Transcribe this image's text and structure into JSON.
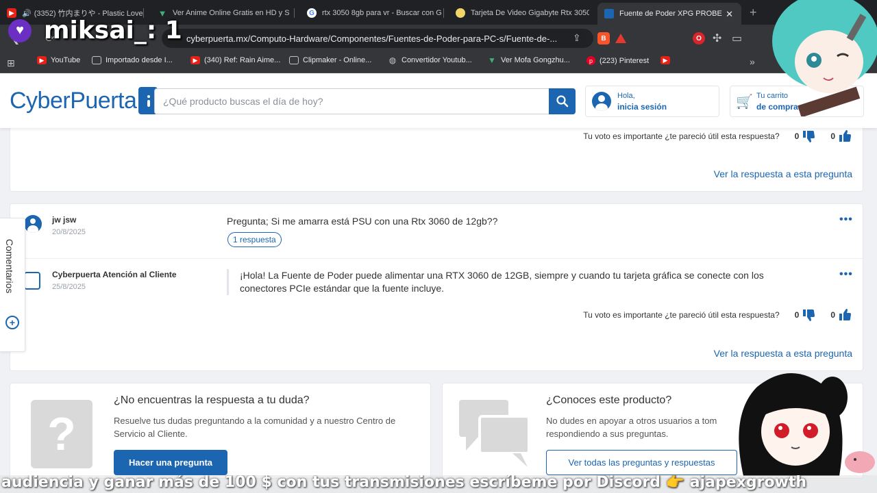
{
  "browser": {
    "tabs": [
      {
        "title": "(3352) 竹内まりや - Plastic Love",
        "icon": "youtube-icon",
        "icon_color": "#e62117"
      },
      {
        "title": "Ver Anime Online Gratis en HD y S",
        "icon": "vue-logo-icon",
        "icon_color": "#3eaf7c"
      },
      {
        "title": "rtx 3050 8gb para vr - Buscar con G",
        "icon": "google-icon",
        "icon_color": "#4285f4"
      },
      {
        "title": "Tarjeta De Video Gigabyte Rtx 3050",
        "icon": "shop-icon",
        "icon_color": "#f3d36b"
      },
      {
        "title": "Fuente de Poder XPG PROBE",
        "icon": "cyberpuerta-icon",
        "icon_color": "#1b65b1"
      }
    ],
    "url": "cyberpuerta.mx/Computo-Hardware/Componentes/Fuentes-de-Poder-para-PC-s/Fuente-de-...",
    "bookmarks": [
      {
        "label": "YouTube",
        "icon": "youtube-icon"
      },
      {
        "label": "Importado desde I...",
        "icon": "folder-icon"
      },
      {
        "label": "(340) Ref: Rain Aime...",
        "icon": "youtube-icon"
      },
      {
        "label": "Clipmaker - Online...",
        "icon": "clipmaker-icon"
      },
      {
        "label": "Convertidor Youtub...",
        "icon": "globe-icon"
      },
      {
        "label": "Ver Mofa Gongzhu...",
        "icon": "vue-logo-icon"
      },
      {
        "label": "(223) Pinterest",
        "icon": "pinterest-icon"
      }
    ],
    "bookmark_overflow": "»"
  },
  "header": {
    "logo": "CyberPuerta",
    "search_placeholder": "¿Qué producto buscas el día de hoy?",
    "login_greeting": "Hola,",
    "login_action": "inicia sesión",
    "cart_line1": "Tu carrito",
    "cart_line2": "de compras"
  },
  "qa": {
    "vote_question": "Tu voto es importante ¿te pareció útil esta respuesta?",
    "see_answer": "Ver la respuesta a esta pregunta",
    "prev_card": {
      "dislikes": "0",
      "likes": "0"
    },
    "question": {
      "author": "jw jsw",
      "date": "20/8/2025",
      "text": "Pregunta; Si me amarra está PSU con una Rtx 3060 de 12gb??",
      "responses": "1 respuesta",
      "answer": {
        "author": "Cyberpuerta Atención al Cliente",
        "date": "25/8/2025",
        "text": "¡Hola! La Fuente de Poder puede alimentar una RTX 3060 de 12GB, siempre y cuando tu tarjeta gráfica se conecte con los conectores PCIe estándar que la fuente incluye.",
        "dislikes": "0",
        "likes": "0"
      }
    }
  },
  "side_tab": {
    "label": "Comentarios"
  },
  "cta": {
    "ask": {
      "title": "¿No encuentras la respuesta a tu duda?",
      "desc": "Resuelve tus dudas preguntando a la comunidad y a nuestro Centro de Servicio al Cliente.",
      "button": "Hacer una pregunta"
    },
    "know": {
      "title": "¿Conoces este producto?",
      "desc": "No dudes en apoyar a otros usuarios a tom respondiendo a sus preguntas.",
      "button": "Ver todas las preguntas y respuestas"
    }
  },
  "overlay": {
    "viewers": "miksai_: 1",
    "ticker": "audiencia y ganar más de 100 $ con tus transmisiones escríbeme por Discord 👉 ajapexgrowth"
  },
  "colors": {
    "brand": "#1b65b1",
    "tab_bar": "#202124",
    "toolbar": "#35363a"
  }
}
